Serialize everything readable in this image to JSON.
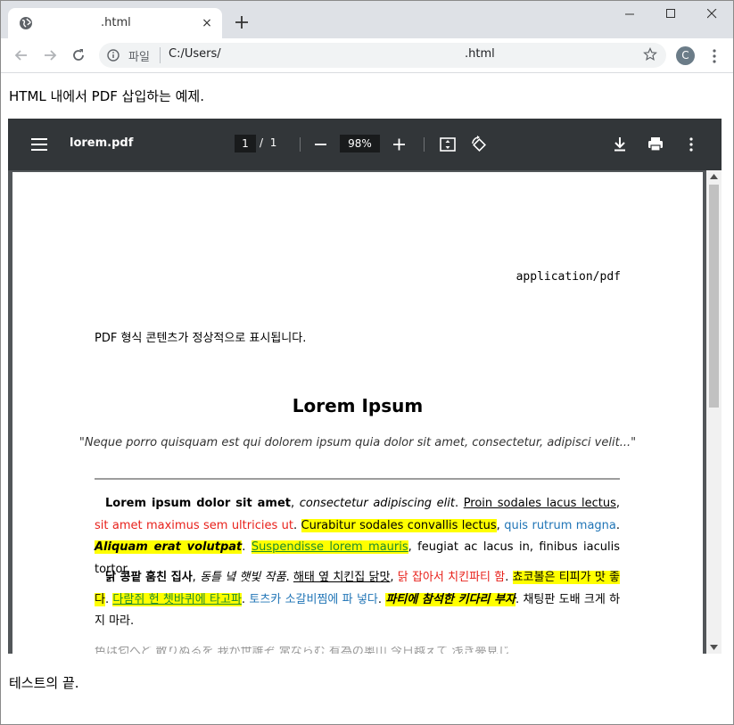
{
  "browser": {
    "tab_title": ".html",
    "tab_close": "×",
    "address_scheme": "파일",
    "address_path": "C:/Users/",
    "address_file": ".html",
    "profile_initial": "C"
  },
  "page": {
    "intro": "HTML 내에서 PDF 삽입하는 예제.",
    "outro": "테스트의 끝."
  },
  "viewer": {
    "file_name": "lorem.pdf",
    "current_page": "1",
    "page_sep": "/",
    "total_pages": "1",
    "zoom": "98%"
  },
  "pdf": {
    "mime": "application/pdf",
    "line": "PDF 형식 콘텐츠가 정상적으로 표시됩니다.",
    "title": "Lorem Ipsum",
    "quote": "\"Neque porro quisquam est qui dolorem ipsum quia dolor sit amet, consectetur, adipisci velit...\"",
    "p1": {
      "bold": "Lorem ipsum dolor sit amet",
      "comma1": ", ",
      "italic": "consectetur adipiscing elit",
      "dot1": ". ",
      "underline": "Proin sodales lacus lectus",
      "comma2": ", ",
      "red": "sit amet maximus sem ultricies ut",
      "dot2": ". ",
      "highlight": "Curabitur sodales convallis lectus",
      "comma3": ", ",
      "blue": "quis rutrum magna",
      "dot3": ". ",
      "bold_italic": "Aliquam erat volutpat",
      "dot4": ". ",
      "green_link": "Suspendisse lorem mauris",
      "tail": ", feugiat ac lacus in, finibus iaculis tortor."
    },
    "p2": {
      "bold": "닭 콩팥 훔친 집사",
      "comma1": ", ",
      "italic": "동틀 녘 햇빛 작품",
      "dot1": ". ",
      "underline": "해태 옆 치킨집 닭맛",
      "comma2": ", ",
      "red": "닭 잡아서 치킨파티 함",
      "dot2": ". ",
      "highlight": "쵸코볼은 티피가 맛 좋다",
      "dot3": ". ",
      "green_link": "다람쥐 헌 쳇바퀴에 타고파",
      "dot4": ". ",
      "blue": "토츠카 소갈비찜에 파 넣다",
      "dot5": ". ",
      "bold_italic": "파티에 참석한 키다리 부자",
      "tail": ". 채팅판 도배 크게 하지 마라."
    },
    "p3_cut": "色は匂へど 散りぬるを 我が世誰ぞ 常ならむ 有為の奥山 今日越えて 浅き夢見じ"
  }
}
